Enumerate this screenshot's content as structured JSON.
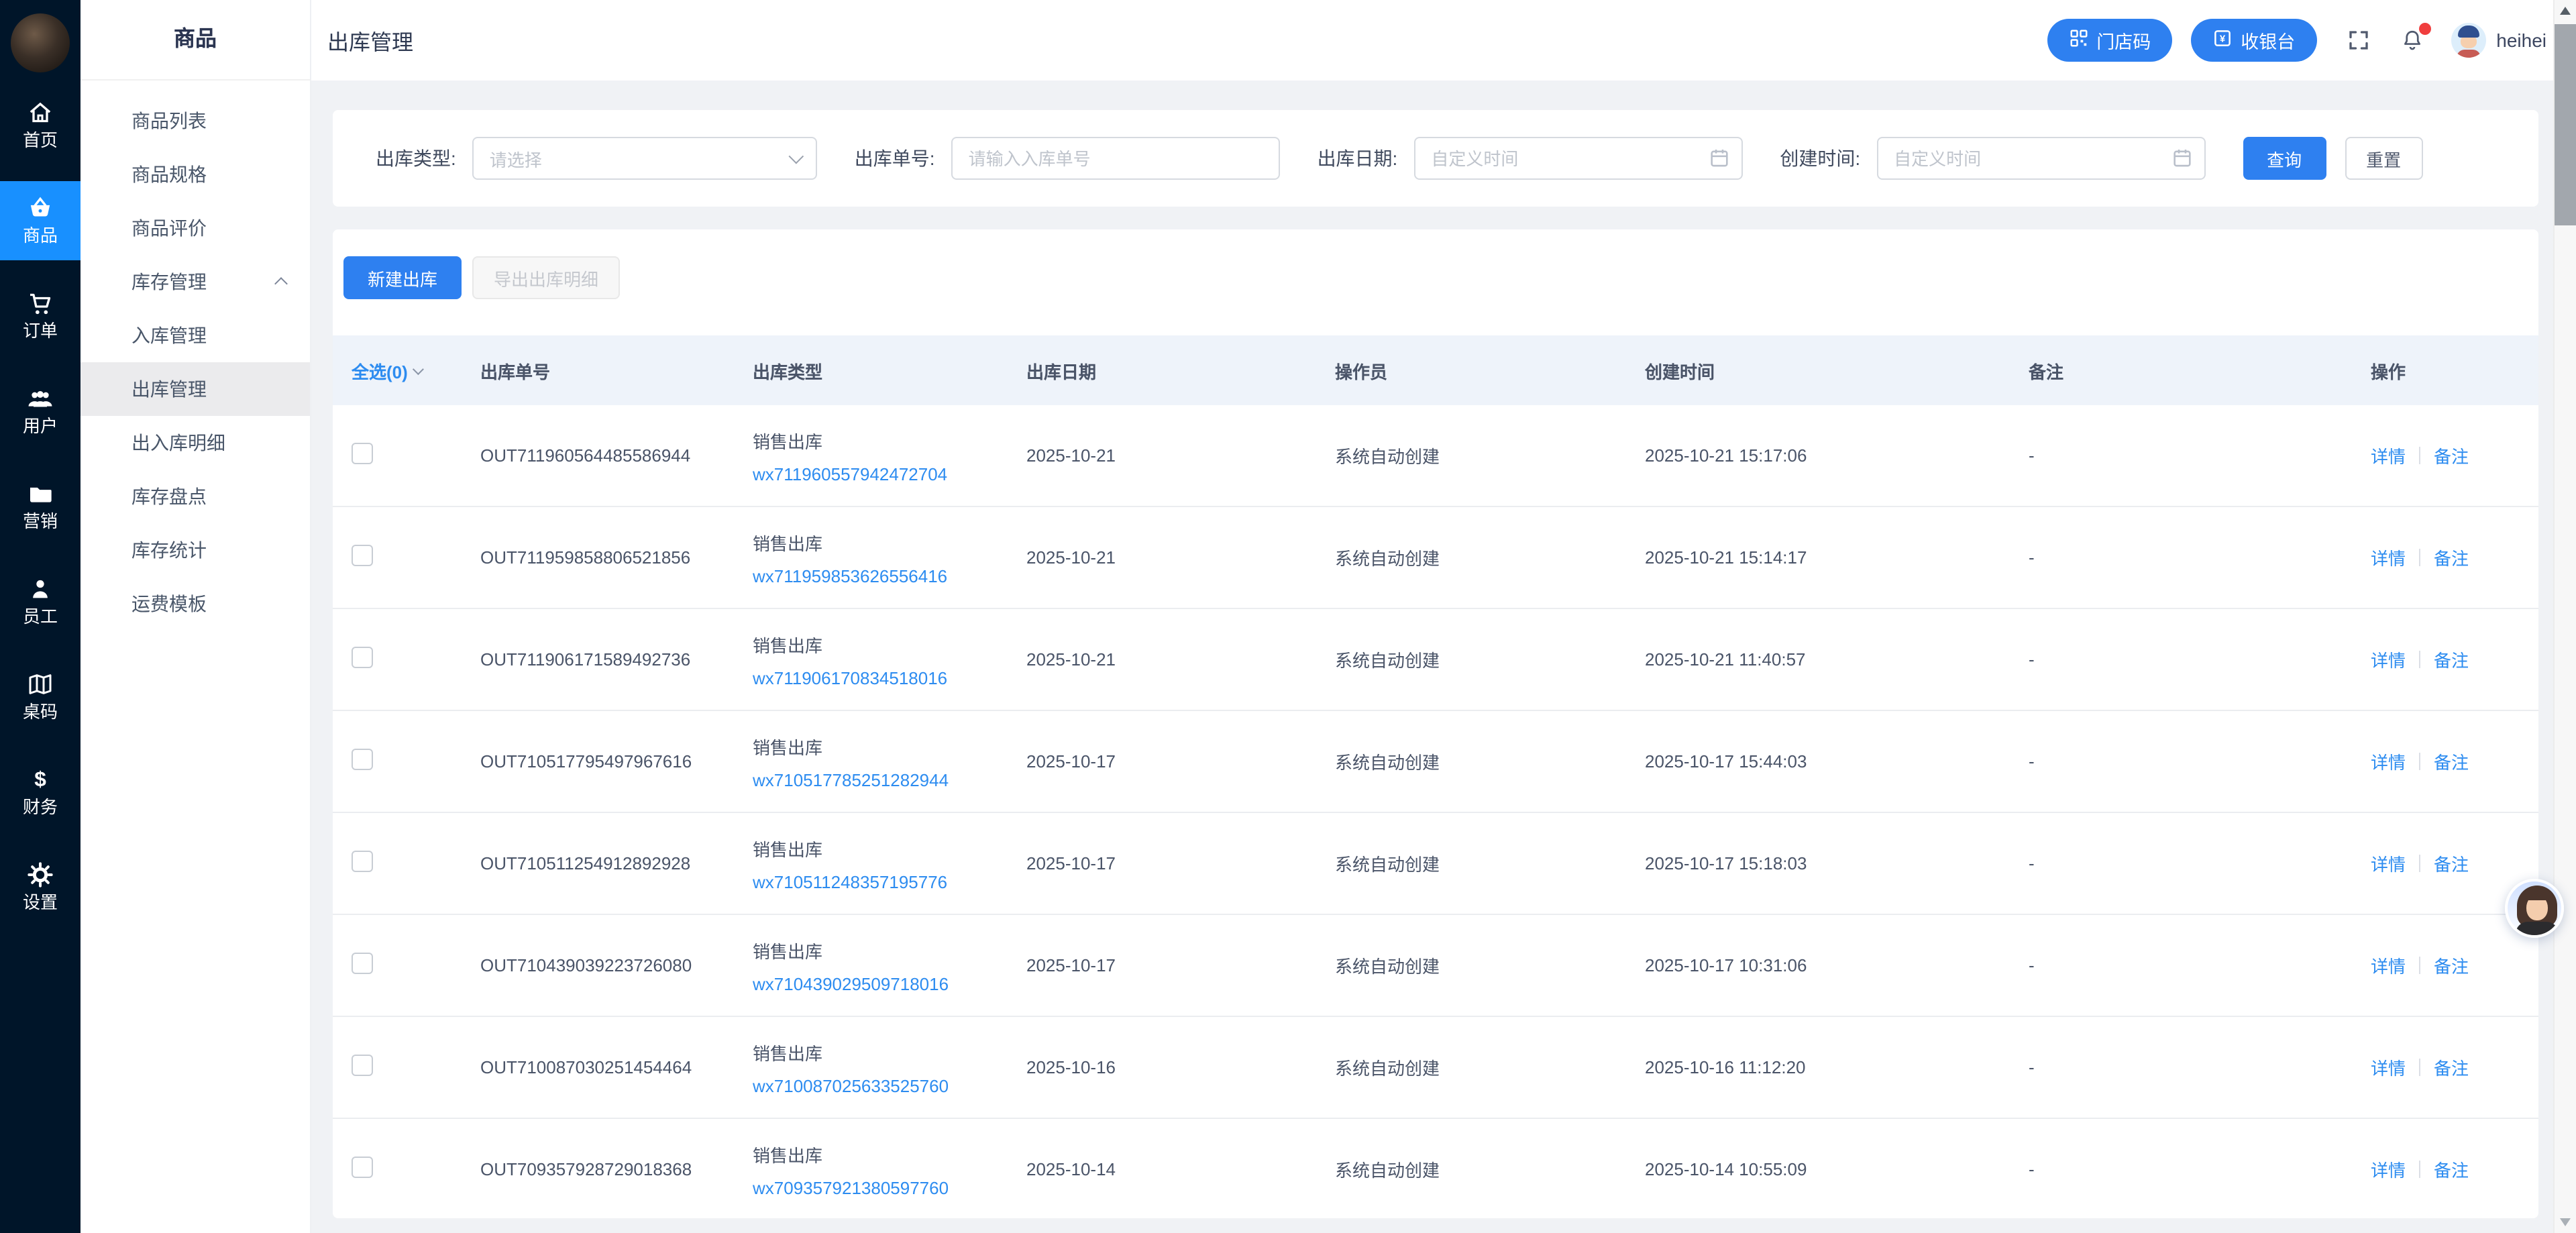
{
  "colors": {
    "primary": "#2e80f0",
    "link": "#2d8cf0",
    "rail_bg": "#001529",
    "rail_active": "#1890ff",
    "page_bg": "#f0f2f5",
    "table_header_bg": "#eef3fa",
    "badge": "#f03e3e"
  },
  "rail": {
    "items": [
      {
        "label": "首页",
        "icon": "home-icon"
      },
      {
        "label": "商品",
        "icon": "basket-icon"
      },
      {
        "label": "订单",
        "icon": "cart-icon"
      },
      {
        "label": "用户",
        "icon": "users-icon"
      },
      {
        "label": "营销",
        "icon": "folder-icon"
      },
      {
        "label": "员工",
        "icon": "person-icon"
      },
      {
        "label": "桌码",
        "icon": "map-icon"
      },
      {
        "label": "财务",
        "icon": "dollar-icon"
      },
      {
        "label": "设置",
        "icon": "gear-icon"
      }
    ]
  },
  "sidebar": {
    "title": "商品",
    "items": [
      {
        "label": "商品列表"
      },
      {
        "label": "商品规格"
      },
      {
        "label": "商品评价"
      },
      {
        "label": "库存管理"
      },
      {
        "label": "入库管理"
      },
      {
        "label": "出库管理"
      },
      {
        "label": "出入库明细"
      },
      {
        "label": "库存盘点"
      },
      {
        "label": "库存统计"
      },
      {
        "label": "运费模板"
      }
    ]
  },
  "header": {
    "title": "出库管理",
    "store_code_label": "门店码",
    "cashier_label": "收银台",
    "username": "heihei"
  },
  "filters": {
    "type_label": "出库类型:",
    "type_placeholder": "请选择",
    "order_label": "出库单号:",
    "order_placeholder": "请输入入库单号",
    "date_label": "出库日期:",
    "date_placeholder": "自定义时间",
    "created_label": "创建时间:",
    "created_placeholder": "自定义时间",
    "search_label": "查询",
    "reset_label": "重置"
  },
  "actions": {
    "new_label": "新建出库",
    "export_label": "导出出库明细"
  },
  "table": {
    "select_all": "全选(0)",
    "headers": [
      "出库单号",
      "出库类型",
      "出库日期",
      "操作员",
      "创建时间",
      "备注",
      "操作"
    ],
    "ops": {
      "detail": "详情",
      "remark_op": "备注"
    },
    "rows": [
      {
        "order_no": "OUT711960564485586944",
        "type": "销售出库",
        "ref": "wx711960557942472704",
        "date": "2025-10-21",
        "operator": "系统自动创建",
        "created": "2025-10-21 15:17:06",
        "remark": "-"
      },
      {
        "order_no": "OUT711959858806521856",
        "type": "销售出库",
        "ref": "wx711959853626556416",
        "date": "2025-10-21",
        "operator": "系统自动创建",
        "created": "2025-10-21 15:14:17",
        "remark": "-"
      },
      {
        "order_no": "OUT711906171589492736",
        "type": "销售出库",
        "ref": "wx711906170834518016",
        "date": "2025-10-21",
        "operator": "系统自动创建",
        "created": "2025-10-21 11:40:57",
        "remark": "-"
      },
      {
        "order_no": "OUT710517795497967616",
        "type": "销售出库",
        "ref": "wx710517785251282944",
        "date": "2025-10-17",
        "operator": "系统自动创建",
        "created": "2025-10-17 15:44:03",
        "remark": "-"
      },
      {
        "order_no": "OUT710511254912892928",
        "type": "销售出库",
        "ref": "wx710511248357195776",
        "date": "2025-10-17",
        "operator": "系统自动创建",
        "created": "2025-10-17 15:18:03",
        "remark": "-"
      },
      {
        "order_no": "OUT710439039223726080",
        "type": "销售出库",
        "ref": "wx710439029509718016",
        "date": "2025-10-17",
        "operator": "系统自动创建",
        "created": "2025-10-17 10:31:06",
        "remark": "-"
      },
      {
        "order_no": "OUT710087030251454464",
        "type": "销售出库",
        "ref": "wx710087025633525760",
        "date": "2025-10-16",
        "operator": "系统自动创建",
        "created": "2025-10-16 11:12:20",
        "remark": "-"
      },
      {
        "order_no": "OUT709357928729018368",
        "type": "销售出库",
        "ref": "wx709357921380597760",
        "date": "2025-10-14",
        "operator": "系统自动创建",
        "created": "2025-10-14 10:55:09",
        "remark": "-"
      }
    ]
  }
}
